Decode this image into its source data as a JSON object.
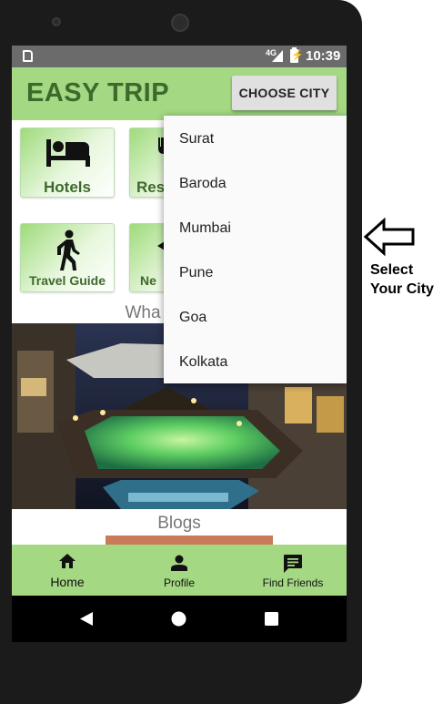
{
  "status_bar": {
    "network": "4G",
    "time": "10:39",
    "battery_glyph": "⚡"
  },
  "app_bar": {
    "title": "EASY TRIP",
    "choose_city_label": "CHOOSE CITY"
  },
  "tiles": [
    {
      "label": "Hotels",
      "icon": "hotel-bed-icon"
    },
    {
      "label": "Resta",
      "icon": "restaurant-icon"
    },
    {
      "label": "Travel Guide",
      "icon": "walking-person-icon"
    },
    {
      "label": "Ne",
      "icon": "nearby-icon"
    }
  ],
  "sections": {
    "whats_new": "Wha",
    "blogs": "Blogs"
  },
  "dropdown": {
    "items": [
      "Surat",
      "Baroda",
      "Mumbai",
      "Pune",
      "Goa",
      "Kolkata"
    ]
  },
  "bottom_nav": [
    {
      "label": "Home",
      "icon": "home-icon",
      "active": true
    },
    {
      "label": "Profile",
      "icon": "person-icon",
      "active": false
    },
    {
      "label": "Find Friends",
      "icon": "chat-icon",
      "active": false
    }
  ],
  "annotation": {
    "hint_text": "Select Your City",
    "icon": "arrow-left-outline-icon"
  },
  "colors": {
    "app_bar": "#a4d883",
    "title_text": "#3d6a2c",
    "status_bar": "#6b6b6b"
  }
}
